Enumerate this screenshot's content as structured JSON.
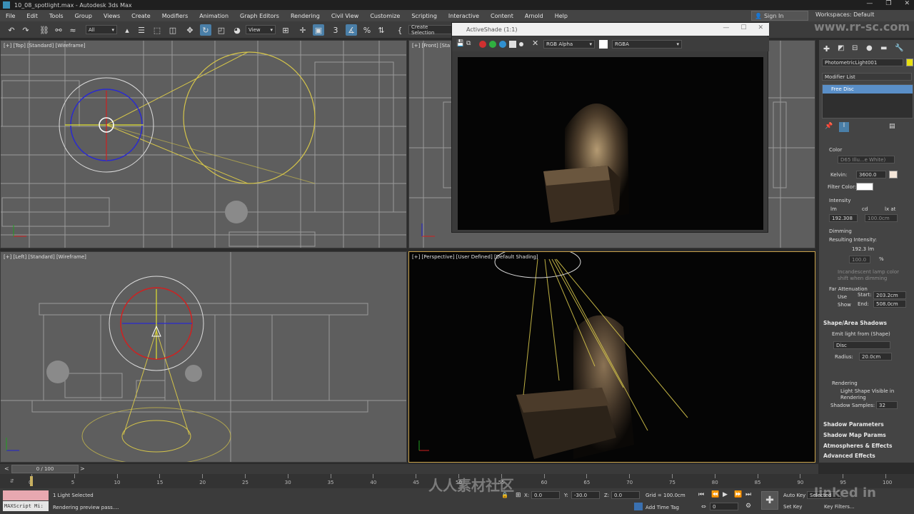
{
  "window": {
    "title": "10_08_spotlight.max - Autodesk 3ds Max",
    "controls": [
      "—",
      "❐",
      "✕"
    ]
  },
  "menu": {
    "items": [
      "File",
      "Edit",
      "Tools",
      "Group",
      "Views",
      "Create",
      "Modifiers",
      "Animation",
      "Graph Editors",
      "Rendering",
      "Civil View",
      "Customize",
      "Scripting",
      "Interactive",
      "Content",
      "Arnold",
      "Help"
    ],
    "sign_in": "Sign In",
    "workspace": "Workspaces: Default"
  },
  "toolbar": {
    "selection_filter": "All",
    "reference_coord": "View",
    "create_selection": "Create Selection"
  },
  "viewports": {
    "top": "[+] [Top] [Standard] [Wireframe]",
    "front": "[+] [Front] [Sta",
    "left": "[+] [Left] [Standard] [Wireframe]",
    "perspective": "[+] [Perspective] [User Defined] [Default Shading]"
  },
  "activeshade": {
    "title": "ActiveShade (1:1)",
    "channel": "RGB Alpha",
    "display": "RGBA"
  },
  "command_panel": {
    "object_name": "PhotometricLight001",
    "modifier_list": "Modifier List",
    "stack_item": "Free Disc",
    "color_section": "Color",
    "color_preset": "D65 Illu...e White)",
    "kelvin_label": "Kelvin:",
    "kelvin_value": "3600.0",
    "filter_color_label": "Filter Color:",
    "intensity_label": "Intensity",
    "unit_lm": "lm",
    "unit_cd": "cd",
    "unit_lx": "lx at",
    "intensity_value": "192.308",
    "lx_distance": "100.0cm",
    "dimming_label": "Dimming",
    "resulting_label": "Resulting Intensity:",
    "resulting_value": "192.3 lm",
    "percent_value": "100.0",
    "percent_sign": "%",
    "incandescent_line1": "Incandescent lamp color",
    "incandescent_line2": "shift when dimming",
    "far_atten_label": "Far Attenuation",
    "use_label": "Use",
    "show_label": "Show",
    "start_label": "Start:",
    "start_value": "203.2cm",
    "end_label": "End:",
    "end_value": "508.0cm",
    "shape_shadows": "Shape/Area Shadows",
    "emit_from": "Emit light from (Shape)",
    "shape_value": "Disc",
    "radius_label": "Radius:",
    "radius_value": "20.0cm",
    "rendering_label": "Rendering",
    "light_shape_visible_1": "Light Shape Visible in",
    "light_shape_visible_2": "Rendering",
    "shadow_samples_label": "Shadow Samples:",
    "shadow_samples_value": "32",
    "rollouts": [
      "Shadow Parameters",
      "Shadow Map Params",
      "Atmospheres & Effects",
      "Advanced Effects"
    ]
  },
  "timeline": {
    "frame_counter": "0 / 100",
    "ticks": [
      "0",
      "5",
      "10",
      "15",
      "20",
      "25",
      "30",
      "35",
      "40",
      "45",
      "50",
      "55",
      "60",
      "65",
      "70",
      "75",
      "80",
      "85",
      "90",
      "95",
      "100"
    ]
  },
  "status": {
    "selected": "1 Light Selected",
    "prompt": "Rendering preview pass....",
    "maxscript": "MAXScript Mi:",
    "x_label": "X:",
    "x_value": "0.0",
    "y_label": "Y:",
    "y_value": "-30.0",
    "z_label": "Z:",
    "z_value": "0.0",
    "grid": "Grid = 100.0cm",
    "add_time_tag": "Add Time Tag",
    "auto_key": "Auto Key",
    "set_key": "Set Key",
    "selected_dd": "Selected",
    "key_filters": "Key Filters...",
    "current_frame": "0"
  },
  "watermarks": [
    "人人素材社区",
    "www.rr-sc.com",
    "linked in"
  ]
}
